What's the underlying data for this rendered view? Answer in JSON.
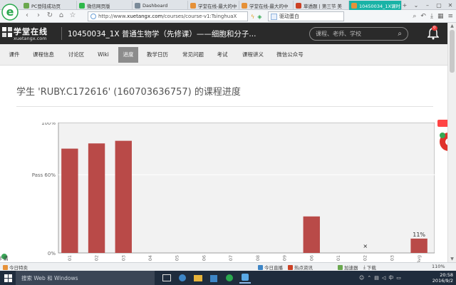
{
  "browser": {
    "tabs": [
      {
        "label": "PC登陆成功页",
        "color": "#6aa84f"
      },
      {
        "label": "微信网页版",
        "color": "#2fb84b"
      },
      {
        "label": "Dashboard",
        "color": "#7a8a99"
      },
      {
        "label": "学堂在线-最大的中",
        "color": "#e69138"
      },
      {
        "label": "学堂在线-最大的中",
        "color": "#e69138"
      },
      {
        "label": "草透题 | 第三节 美",
        "color": "#cc4125"
      },
      {
        "label": "10450034_1X课时",
        "color": "#e69138"
      }
    ],
    "url_prefix": "http://www.",
    "url_domain": "xuetangx.com",
    "url_path": "/courses/course-v1:TsinghuaX",
    "search_text": "驱动蛋白"
  },
  "site": {
    "brand_name": "学堂在线",
    "brand_domain": "xuetangx.com",
    "course_title": "10450034_1X 普通生物学（先修课）——细胞和分子...",
    "search_placeholder": "课程、老师、学校",
    "notification_count": "0",
    "nav": [
      "课件",
      "课程信息",
      "讨论区",
      "Wiki",
      "进度",
      "教学日历",
      "常见问题",
      "考试",
      "课程讲义",
      "微信公众号"
    ],
    "active_nav": "进度"
  },
  "page": {
    "title": "学生 'RUBY.C172616' (1607036367​57) 的课程进度",
    "side_link": "请你留言"
  },
  "chart_data": {
    "type": "bar",
    "categories": [
      "01",
      "02",
      "03",
      "04",
      "05",
      "06",
      "07",
      "08",
      "09",
      "06",
      "01",
      "02",
      "03",
      "Avg"
    ],
    "values": [
      80,
      84,
      86,
      0,
      0,
      0,
      0,
      0,
      0,
      28,
      0,
      0,
      0,
      11
    ],
    "ylim": [
      0,
      100
    ],
    "y_ticks": [
      "0%",
      "Pass 60%",
      "100%"
    ],
    "pass_line": 60,
    "bar_label": "11%",
    "marker_category_index": 11,
    "marker_symbol": "×",
    "grid": false,
    "bar_color": "#b94a48"
  },
  "statusbar": {
    "left": "今日特卖",
    "items": [
      "今日直播",
      "热点资讯",
      "加速器",
      "下载"
    ],
    "zoom": "110%"
  },
  "taskbar": {
    "search_placeholder": "搜索 Web 和 Windows",
    "time": "20:58",
    "date": "2016/9/2"
  }
}
